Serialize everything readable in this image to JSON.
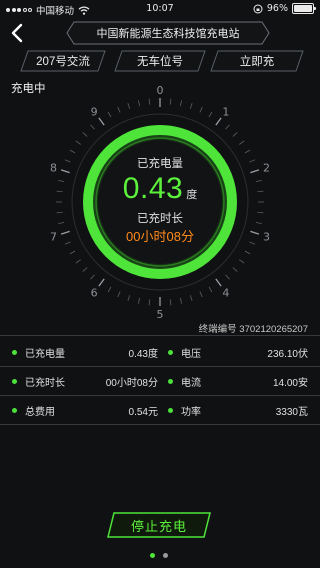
{
  "status_bar": {
    "carrier": "中国移动",
    "time": "10:07",
    "battery": "96%"
  },
  "header": {
    "title": "中国新能源生态科技馆充电站"
  },
  "tabs": [
    {
      "label": "207号交流"
    },
    {
      "label": "无车位号"
    },
    {
      "label": "立即充"
    }
  ],
  "charging_status": "充电中",
  "gauge": {
    "ticks": [
      "0",
      "1",
      "2",
      "3",
      "4",
      "5",
      "6",
      "7",
      "8",
      "9"
    ],
    "energy_label": "已充电量",
    "energy_value": "0.43",
    "energy_unit": "度",
    "duration_label": "已充时长",
    "duration_value": "00小时08分"
  },
  "terminal": "终端编号 3702120265207",
  "metrics": [
    {
      "left_label": "已充电量",
      "left_value": "0.43度",
      "right_label": "电压",
      "right_value": "236.10伏"
    },
    {
      "left_label": "已充时长",
      "left_value": "00小时08分",
      "right_label": "电流",
      "right_value": "14.00安"
    },
    {
      "left_label": "总费用",
      "left_value": "0.54元",
      "right_label": "功率",
      "right_value": "3330瓦"
    }
  ],
  "stop_button": "停止充电",
  "colors": {
    "accent": "#5cf23b",
    "orange": "#ff8a1a",
    "background": "#101113"
  }
}
